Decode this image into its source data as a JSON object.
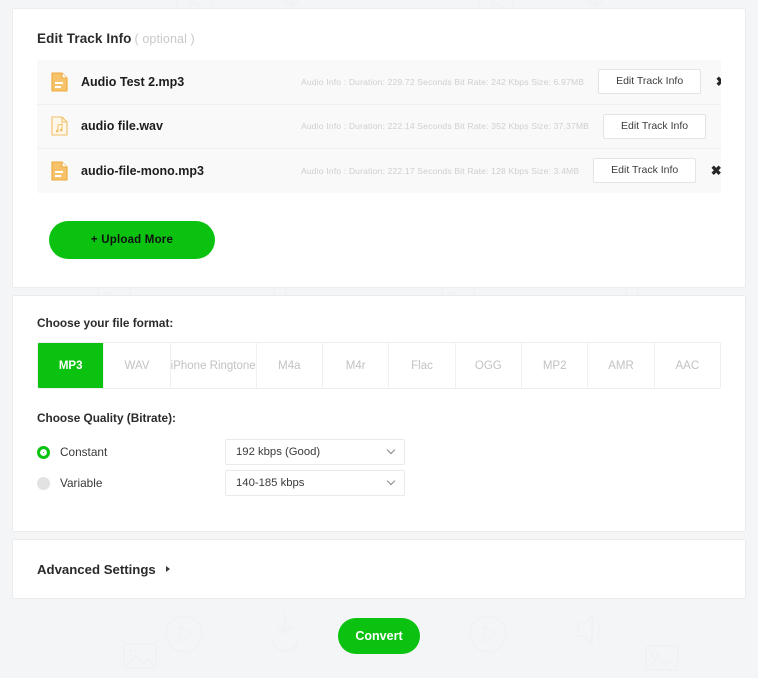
{
  "tracks_section": {
    "title": "Edit Track Info",
    "optional": "( optional )",
    "rows": [
      {
        "icon": "audio-file-icon",
        "name": "Audio Test 2.mp3",
        "info": "Audio Info : Duration: 229.72 Seconds Bit Rate: 242 Kbps Size: 6.97MB",
        "edit_label": "Edit Track Info",
        "remove_label": "✖"
      },
      {
        "icon": "audio-file-icon",
        "name": "audio file.wav",
        "info": "Audio Info : Duration: 222.14 Seconds Bit Rate: 352 Kbps Size: 37.37MB",
        "edit_label": "Edit Track Info",
        "remove_label": "✖"
      },
      {
        "icon": "audio-file-icon",
        "name": "audio-file-mono.mp3",
        "info": "Audio Info : Duration: 222.17 Seconds Bit Rate: 128 Kbps Size: 3.4MB",
        "edit_label": "Edit Track Info",
        "remove_label": "✖"
      }
    ],
    "upload_more_label": "+ Upload More"
  },
  "format_section": {
    "label": "Choose your file format:",
    "tabs": [
      {
        "label": "MP3",
        "selected": true
      },
      {
        "label": "WAV",
        "selected": false
      },
      {
        "label": "iPhone Ringtone",
        "selected": false
      },
      {
        "label": "M4a",
        "selected": false
      },
      {
        "label": "M4r",
        "selected": false
      },
      {
        "label": "Flac",
        "selected": false
      },
      {
        "label": "OGG",
        "selected": false
      },
      {
        "label": "MP2",
        "selected": false
      },
      {
        "label": "AMR",
        "selected": false
      },
      {
        "label": "AAC",
        "selected": false
      }
    ]
  },
  "quality_section": {
    "label": "Choose Quality (Bitrate):",
    "constant": {
      "radio_label": "Constant",
      "selected": true,
      "value": "192 kbps (Good)"
    },
    "variable": {
      "radio_label": "Variable",
      "selected": false,
      "value": "140-185 kbps"
    }
  },
  "advanced_section": {
    "title": "Advanced Settings",
    "arrow": "chevron-right-icon"
  },
  "convert": {
    "label": "Convert"
  },
  "colors": {
    "accent_green": "#0ac20f",
    "file_icon_orange": "#f2b544",
    "card_bg": "#ffffff",
    "page_bg": "#f4f5f7",
    "track_list_bg": "#f9f9f9",
    "info_text": "#cfcfcf"
  }
}
